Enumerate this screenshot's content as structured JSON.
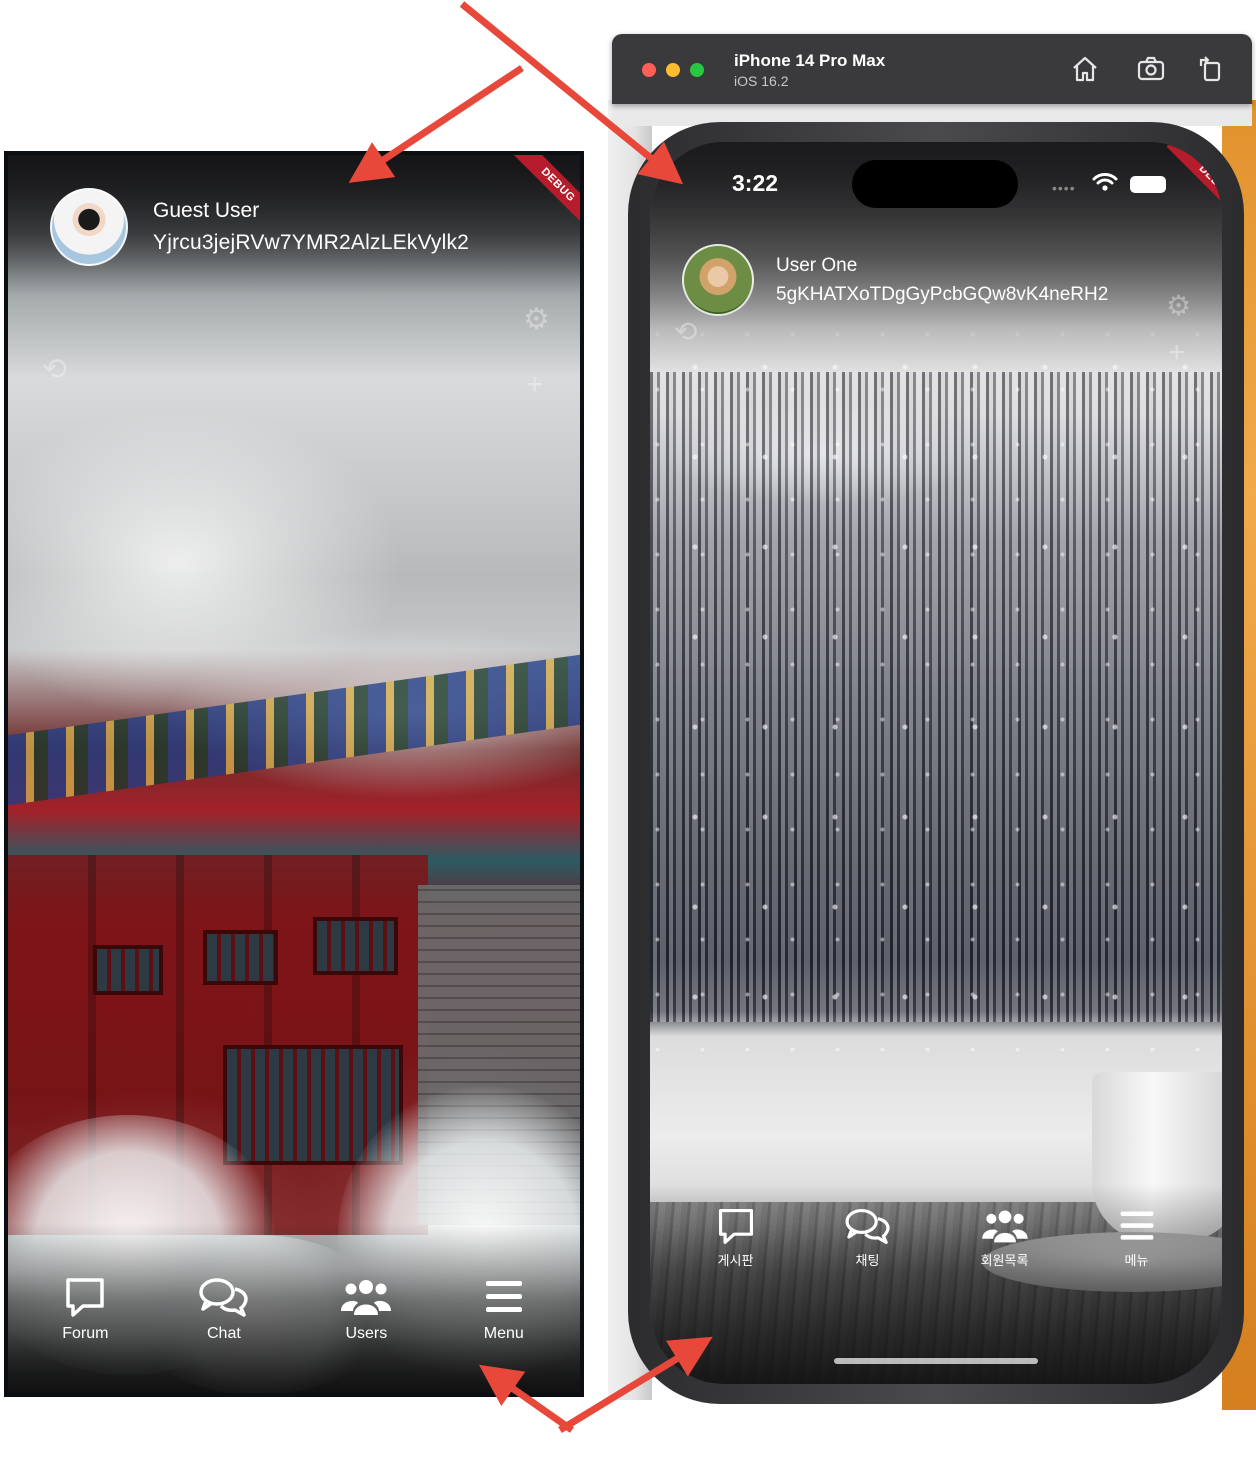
{
  "left_app": {
    "user": {
      "name": "Guest User",
      "uid": "Yjrcu3jejRVw7YMR2AlzLEkVylk2"
    },
    "debug_banner": "DEBUG",
    "nav": [
      {
        "label": "Forum",
        "icon": "comment-icon"
      },
      {
        "label": "Chat",
        "icon": "chat-bubbles-icon"
      },
      {
        "label": "Users",
        "icon": "users-icon"
      },
      {
        "label": "Menu",
        "icon": "menu-icon"
      }
    ]
  },
  "simulator": {
    "device": "iPhone 14 Pro Max",
    "os": "iOS 16.2",
    "toolbar_icons": [
      "home-icon",
      "screenshot-icon",
      "rotate-icon"
    ],
    "status_bar": {
      "time": "3:22"
    },
    "debug_banner": "DEBUG",
    "user": {
      "name": "User One",
      "uid": "5gKHATXoTDgGyPcbGQw8vK4neRH2"
    },
    "nav": [
      {
        "label": "게시판",
        "icon": "comment-icon"
      },
      {
        "label": "채팅",
        "icon": "chat-bubbles-icon"
      },
      {
        "label": "회원목록",
        "icon": "users-icon"
      },
      {
        "label": "메뉴",
        "icon": "menu-icon"
      }
    ]
  },
  "colors": {
    "arrow": "#e8483a",
    "debug_ribbon": "#b71c2c",
    "toolbar": "#3a3a3c"
  }
}
